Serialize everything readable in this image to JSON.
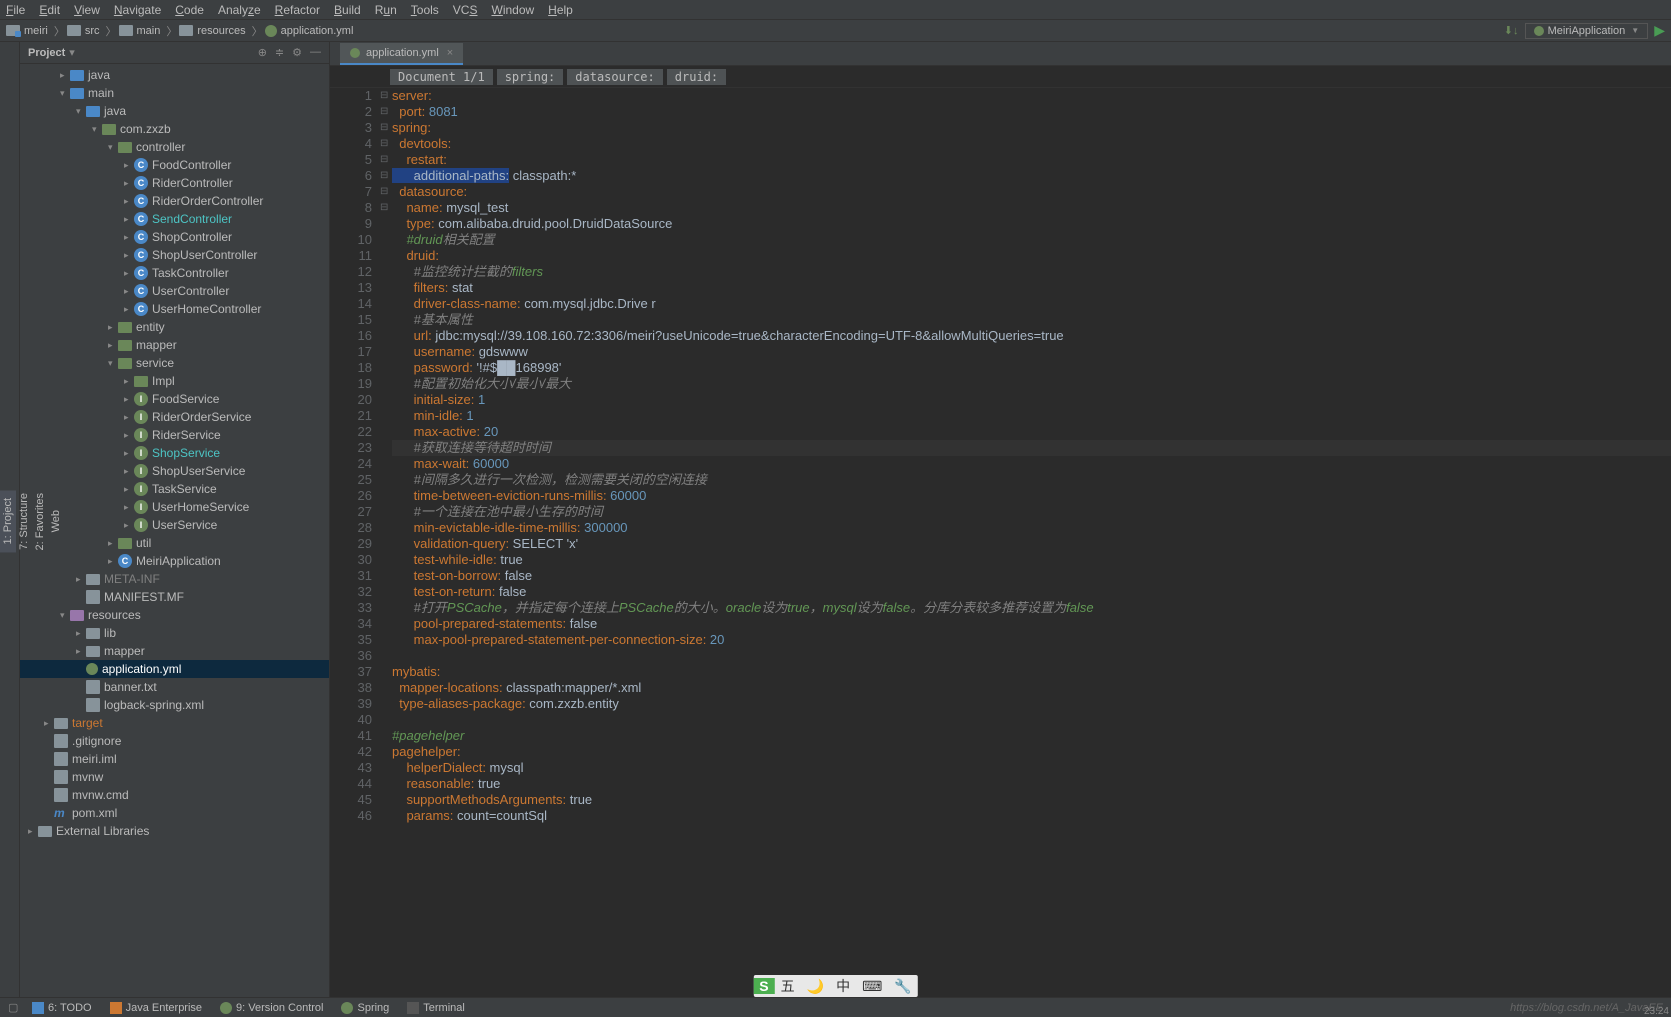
{
  "menu": [
    "File",
    "Edit",
    "View",
    "Navigate",
    "Code",
    "Analyze",
    "Refactor",
    "Build",
    "Run",
    "Tools",
    "VCS",
    "Window",
    "Help"
  ],
  "breadcrumbs": [
    "meiri",
    "src",
    "main",
    "resources",
    "application.yml"
  ],
  "run_config": "MeiriApplication",
  "project_panel": {
    "title": "Project"
  },
  "tree": {
    "java_root": "java",
    "main": "main",
    "java": "java",
    "pkg": "com.zxzb",
    "controller": "controller",
    "controllers": [
      "FoodController",
      "RiderController",
      "RiderOrderController",
      "SendController",
      "ShopController",
      "ShopUserController",
      "TaskController",
      "UserController",
      "UserHomeController"
    ],
    "entity": "entity",
    "mapper": "mapper",
    "service": "service",
    "impl": "Impl",
    "services": [
      "FoodService",
      "RiderOrderService",
      "RiderService",
      "ShopService",
      "ShopUserService",
      "TaskService",
      "UserHomeService",
      "UserService"
    ],
    "util": "util",
    "app": "MeiriApplication",
    "metainf": "META-INF",
    "manifest": "MANIFEST.MF",
    "resources": "resources",
    "lib": "lib",
    "mapper2": "mapper",
    "appyml": "application.yml",
    "banner": "banner.txt",
    "logback": "logback-spring.xml",
    "target": "target",
    "gitignore": ".gitignore",
    "iml": "meiri.iml",
    "mvnw": "mvnw",
    "mvnwcmd": "mvnw.cmd",
    "pom": "pom.xml",
    "extlib": "External Libraries"
  },
  "editor_tab": "application.yml",
  "crumbs": [
    "Document 1/1",
    "spring:",
    "datasource:",
    "druid:"
  ],
  "code_lines": [
    {
      "n": 1,
      "tokens": [
        [
          "key",
          "server:"
        ]
      ]
    },
    {
      "n": 2,
      "tokens": [
        [
          "key",
          "  port: "
        ],
        [
          "num",
          "8081"
        ]
      ]
    },
    {
      "n": 3,
      "tokens": [
        [
          "key",
          "spring:"
        ]
      ]
    },
    {
      "n": 4,
      "tokens": [
        [
          "key",
          "  devtools:"
        ]
      ]
    },
    {
      "n": 5,
      "tokens": [
        [
          "key",
          "    restart:"
        ]
      ]
    },
    {
      "n": 6,
      "tokens": [
        [
          "hl",
          "      additional-paths:"
        ],
        [
          "str",
          " classpath:*"
        ]
      ]
    },
    {
      "n": 7,
      "tokens": [
        [
          "key",
          "  datasource:"
        ]
      ]
    },
    {
      "n": 8,
      "tokens": [
        [
          "key",
          "    name: "
        ],
        [
          "str",
          "mysql_test"
        ]
      ]
    },
    {
      "n": 9,
      "tokens": [
        [
          "key",
          "    type: "
        ],
        [
          "str",
          "com.alibaba.druid.pool.DruidDataSource"
        ]
      ]
    },
    {
      "n": 10,
      "tokens": [
        [
          "cmt-em",
          "    #druid"
        ],
        [
          "cmt",
          "相关配置"
        ]
      ]
    },
    {
      "n": 11,
      "tokens": [
        [
          "key",
          "    druid:"
        ]
      ]
    },
    {
      "n": 12,
      "tokens": [
        [
          "cmt",
          "      #监控统计拦截的"
        ],
        [
          "cmt-em",
          "filters"
        ]
      ]
    },
    {
      "n": 13,
      "tokens": [
        [
          "key",
          "      filters: "
        ],
        [
          "str",
          "stat"
        ]
      ]
    },
    {
      "n": 14,
      "tokens": [
        [
          "key",
          "      driver-class-name: "
        ],
        [
          "str",
          "com.mysql.jdbc.Drive r"
        ]
      ]
    },
    {
      "n": 15,
      "tokens": [
        [
          "cmt",
          "      #基本属性"
        ]
      ]
    },
    {
      "n": 16,
      "tokens": [
        [
          "key",
          "      url: "
        ],
        [
          "str",
          "jdbc:mysql://39.108.160.72:3306/meiri?useUnicode=true&characterEncoding=UTF-8&allowMultiQueries=true"
        ]
      ]
    },
    {
      "n": 17,
      "tokens": [
        [
          "key",
          "      username: "
        ],
        [
          "str",
          "gdswww"
        ]
      ]
    },
    {
      "n": 18,
      "tokens": [
        [
          "key",
          "      password: "
        ],
        [
          "str",
          "'!#$██168998'"
        ]
      ]
    },
    {
      "n": 19,
      "tokens": [
        [
          "cmt",
          "      #配置初始化大小/最小/最大"
        ]
      ]
    },
    {
      "n": 20,
      "tokens": [
        [
          "key",
          "      initial-size: "
        ],
        [
          "num",
          "1"
        ]
      ]
    },
    {
      "n": 21,
      "tokens": [
        [
          "key",
          "      min-idle: "
        ],
        [
          "num",
          "1"
        ]
      ]
    },
    {
      "n": 22,
      "tokens": [
        [
          "key",
          "      max-active: "
        ],
        [
          "num",
          "20"
        ]
      ]
    },
    {
      "n": 23,
      "current": true,
      "tokens": [
        [
          "cmt",
          "      #获取连接等待超时时间"
        ]
      ]
    },
    {
      "n": 24,
      "tokens": [
        [
          "key",
          "      max-wait: "
        ],
        [
          "num",
          "60000"
        ]
      ]
    },
    {
      "n": 25,
      "tokens": [
        [
          "cmt",
          "      #间隔多久进行一次检测，检测需要关闭的空闲连接"
        ]
      ]
    },
    {
      "n": 26,
      "tokens": [
        [
          "key",
          "      time-between-eviction-runs-millis: "
        ],
        [
          "num",
          "60000"
        ]
      ]
    },
    {
      "n": 27,
      "tokens": [
        [
          "cmt",
          "      #一个连接在池中最小生存的时间"
        ]
      ]
    },
    {
      "n": 28,
      "tokens": [
        [
          "key",
          "      min-evictable-idle-time-millis: "
        ],
        [
          "num",
          "300000"
        ]
      ]
    },
    {
      "n": 29,
      "tokens": [
        [
          "key",
          "      validation-query: "
        ],
        [
          "str",
          "SELECT 'x'"
        ]
      ]
    },
    {
      "n": 30,
      "tokens": [
        [
          "key",
          "      test-while-idle: "
        ],
        [
          "str",
          "true"
        ]
      ]
    },
    {
      "n": 31,
      "tokens": [
        [
          "key",
          "      test-on-borrow: "
        ],
        [
          "str",
          "false"
        ]
      ]
    },
    {
      "n": 32,
      "tokens": [
        [
          "key",
          "      test-on-return: "
        ],
        [
          "str",
          "false"
        ]
      ]
    },
    {
      "n": 33,
      "tokens": [
        [
          "cmt",
          "      #打开"
        ],
        [
          "cmt-em",
          "PSCache"
        ],
        [
          "cmt",
          "，并指定每个连接上"
        ],
        [
          "cmt-em",
          "PSCache"
        ],
        [
          "cmt",
          "的大小。"
        ],
        [
          "cmt-em",
          "oracle"
        ],
        [
          "cmt",
          "设为"
        ],
        [
          "cmt-em",
          "true"
        ],
        [
          "cmt",
          "，"
        ],
        [
          "cmt-em",
          "mysql"
        ],
        [
          "cmt",
          "设为"
        ],
        [
          "cmt-em",
          "false"
        ],
        [
          "cmt",
          "。分库分表较多推荐设置为"
        ],
        [
          "cmt-em",
          "false"
        ]
      ]
    },
    {
      "n": 34,
      "tokens": [
        [
          "key",
          "      pool-prepared-statements: "
        ],
        [
          "str",
          "false"
        ]
      ]
    },
    {
      "n": 35,
      "tokens": [
        [
          "key",
          "      max-pool-prepared-statement-per-connection-size: "
        ],
        [
          "num",
          "20"
        ]
      ]
    },
    {
      "n": 36,
      "tokens": [
        [
          "str",
          ""
        ]
      ]
    },
    {
      "n": 37,
      "tokens": [
        [
          "key",
          "mybatis:"
        ]
      ]
    },
    {
      "n": 38,
      "tokens": [
        [
          "key",
          "  mapper-locations: "
        ],
        [
          "str",
          "classpath:mapper/*.xml"
        ]
      ]
    },
    {
      "n": 39,
      "tokens": [
        [
          "key",
          "  type-aliases-package: "
        ],
        [
          "str",
          "com.zxzb.entity"
        ]
      ]
    },
    {
      "n": 40,
      "tokens": [
        [
          "str",
          ""
        ]
      ]
    },
    {
      "n": 41,
      "tokens": [
        [
          "cmt-em",
          "#pagehelper"
        ]
      ]
    },
    {
      "n": 42,
      "tokens": [
        [
          "key",
          "pagehelper:"
        ]
      ]
    },
    {
      "n": 43,
      "tokens": [
        [
          "key",
          "    helperDialect: "
        ],
        [
          "str",
          "mysql"
        ]
      ]
    },
    {
      "n": 44,
      "tokens": [
        [
          "key",
          "    reasonable: "
        ],
        [
          "str",
          "true"
        ]
      ]
    },
    {
      "n": 45,
      "tokens": [
        [
          "key",
          "    supportMethodsArguments: "
        ],
        [
          "str",
          "true"
        ]
      ]
    },
    {
      "n": 46,
      "tokens": [
        [
          "key",
          "    params: "
        ],
        [
          "str",
          "count=countSql"
        ]
      ]
    }
  ],
  "bottom": [
    "6: TODO",
    "Java Enterprise",
    "9: Version Control",
    "Spring",
    "Terminal"
  ],
  "watermark": "https://blog.csdn.net/A_JavaEE",
  "ime": [
    "五",
    "🌙",
    "中",
    "⌨",
    "🔧"
  ],
  "time": "23:24"
}
